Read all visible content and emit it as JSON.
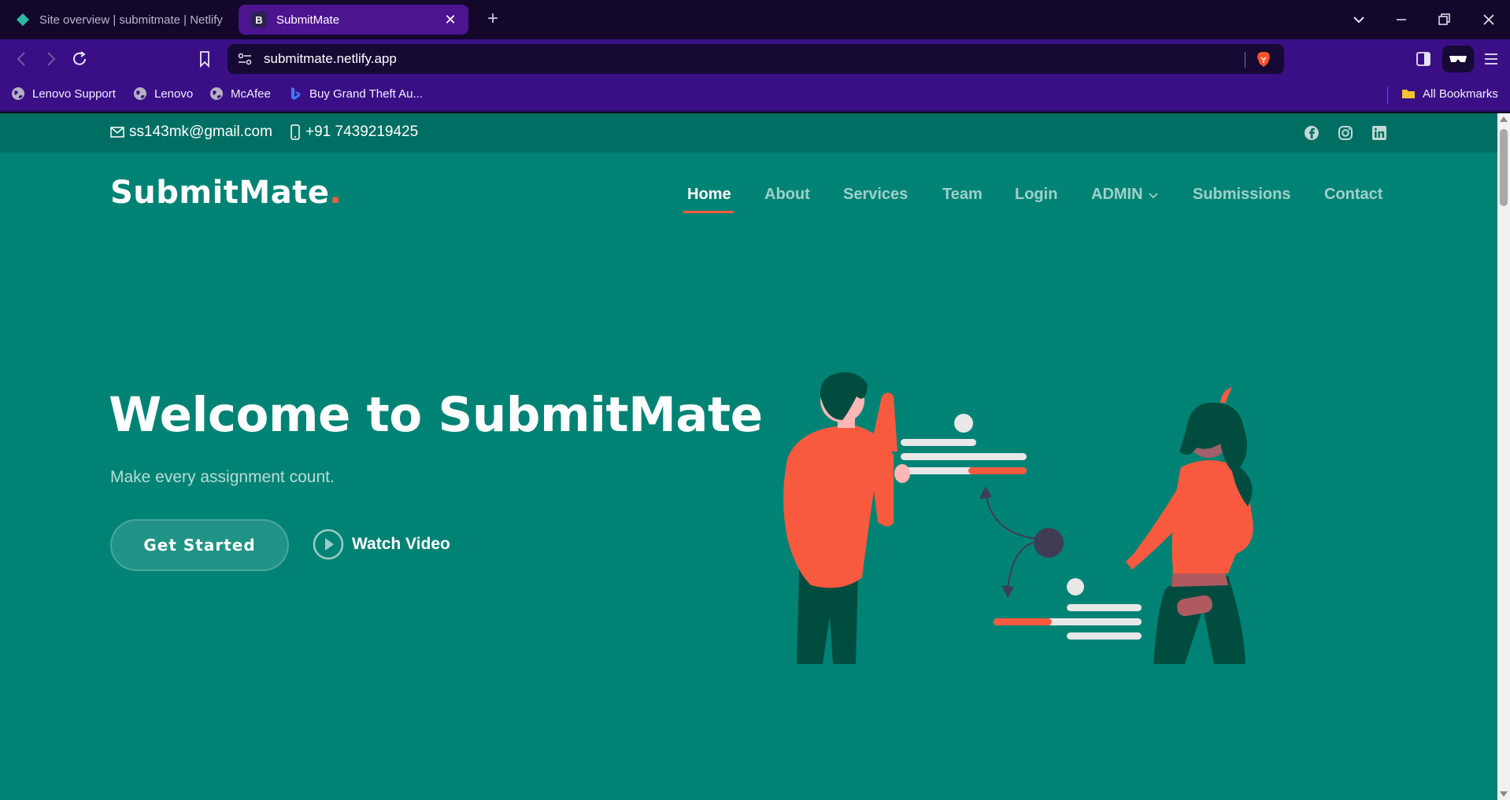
{
  "browser": {
    "tabs": [
      {
        "title": "Site overview | submitmate | Netlify",
        "active": false,
        "favicon": "netlify-diamond-icon"
      },
      {
        "title": "SubmitMate",
        "active": true,
        "favicon": "bootstrap-b-icon",
        "favicon_letter": "B"
      }
    ],
    "url": "submitmate.netlify.app",
    "bookmarks": [
      {
        "label": "Lenovo Support",
        "icon": "globe-icon"
      },
      {
        "label": "Lenovo",
        "icon": "globe-icon"
      },
      {
        "label": "McAfee",
        "icon": "globe-icon"
      },
      {
        "label": "Buy Grand Theft Au...",
        "icon": "bing-icon"
      }
    ],
    "all_bookmarks_label": "All Bookmarks",
    "colors": {
      "tabbar": "#13082c",
      "toolbar": "#3a0f86",
      "active_tab": "#4c148f"
    }
  },
  "site": {
    "topbar": {
      "email": "ss143mk@gmail.com",
      "phone": "+91 7439219425",
      "socials": [
        "facebook-icon",
        "instagram-icon",
        "linkedin-icon"
      ]
    },
    "logo": {
      "text": "SubmitMate",
      "dot": "."
    },
    "nav": [
      {
        "label": "Home",
        "active": true
      },
      {
        "label": "About"
      },
      {
        "label": "Services"
      },
      {
        "label": "Team"
      },
      {
        "label": "Login"
      },
      {
        "label": "ADMIN",
        "dropdown": true
      },
      {
        "label": "Submissions"
      },
      {
        "label": "Contact"
      }
    ],
    "hero": {
      "title": "Welcome to SubmitMate",
      "subtitle": "Make every assignment count.",
      "cta_label": "Get Started",
      "video_label": "Watch Video"
    },
    "colors": {
      "background": "#008374",
      "topbar": "#006e62",
      "accent": "#f85a40",
      "dark_green": "#004d40"
    }
  }
}
